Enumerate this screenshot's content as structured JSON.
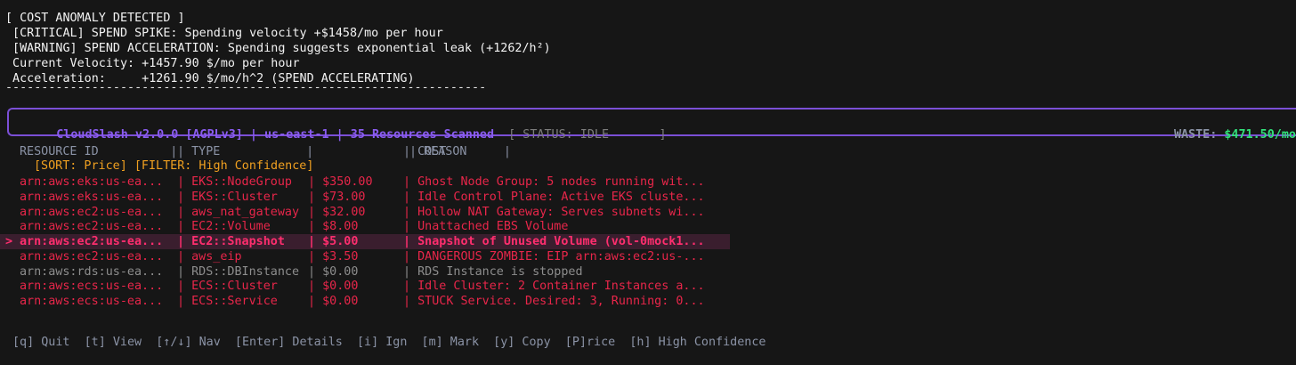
{
  "alert": {
    "heading": "[ COST ANOMALY DETECTED ]",
    "lines": [
      " [CRITICAL] SPEND SPIKE: Spending velocity +$1458/mo per hour",
      " [WARNING] SPEND ACCELERATION: Spending suggests exponential leak (+1262/h²)",
      " Current Velocity: +1457.90 $/mo per hour",
      " Acceleration:     +1261.90 $/mo/h^2 (SPEND ACCELERATING)"
    ],
    "separator": "-------------------------------------------------------------------"
  },
  "status": {
    "title": "CloudSlash v2.0.0 [AGPLv3] | us-east-1 | 35 Resources Scanned",
    "state": "[ STATUS: IDLE       ]",
    "waste_label": "WASTE: ",
    "waste_value": "$471.50/mo"
  },
  "table": {
    "headers": {
      "id": "RESOURCE ID          |",
      "type": "| TYPE            |",
      "cost": "| COST        |",
      "reason": "| REASON"
    },
    "sort_filter": "[SORT: Price] [FILTER: High Confidence]",
    "cursor": ">",
    "rows": [
      {
        "id": "arn:aws:eks:us-ea...",
        "type": "| EKS::NodeGroup",
        "cost": "| $350.00",
        "reason": "| Ghost Node Group: 5 nodes running wit...",
        "style": "red"
      },
      {
        "id": "arn:aws:eks:us-ea...",
        "type": "| EKS::Cluster",
        "cost": "| $73.00",
        "reason": "| Idle Control Plane: Active EKS cluste...",
        "style": "red"
      },
      {
        "id": "arn:aws:ec2:us-ea...",
        "type": "| aws_nat_gateway",
        "cost": "| $32.00",
        "reason": "| Hollow NAT Gateway: Serves subnets wi...",
        "style": "red"
      },
      {
        "id": "arn:aws:ec2:us-ea...",
        "type": "| EC2::Volume",
        "cost": "| $8.00",
        "reason": "| Unattached EBS Volume",
        "style": "red"
      },
      {
        "id": "arn:aws:ec2:us-ea...",
        "type": "| EC2::Snapshot",
        "cost": "| $5.00",
        "reason": "| Snapshot of Unused Volume (vol-0mock1...",
        "style": "selected"
      },
      {
        "id": "arn:aws:ec2:us-ea...",
        "type": "| aws_eip",
        "cost": "| $3.50",
        "reason": "| DANGEROUS ZOMBIE: EIP arn:aws:ec2:us-...",
        "style": "red"
      },
      {
        "id": "arn:aws:rds:us-ea...",
        "type": "| RDS::DBInstance",
        "cost": "| $0.00",
        "reason": "| RDS Instance is stopped",
        "style": "gray"
      },
      {
        "id": "arn:aws:ecs:us-ea...",
        "type": "| ECS::Cluster",
        "cost": "| $0.00",
        "reason": "| Idle Cluster: 2 Container Instances a...",
        "style": "red"
      },
      {
        "id": "arn:aws:ecs:us-ea...",
        "type": "| ECS::Service",
        "cost": "| $0.00",
        "reason": "| STUCK Service. Desired: 3, Running: 0...",
        "style": "red"
      }
    ]
  },
  "footer": {
    "keys": "[q] Quit  [t] View  [↑/↓] Nav  [Enter] Details  [i] Ign  [m] Mark  [y] Copy  [P]rice  [h] High Confidence"
  },
  "colors": {
    "accent": "#7b4fd6",
    "critical": "#e8264a",
    "selected": "#ff2e6e",
    "waste": "#31e07a",
    "sort": "#f0a020"
  }
}
